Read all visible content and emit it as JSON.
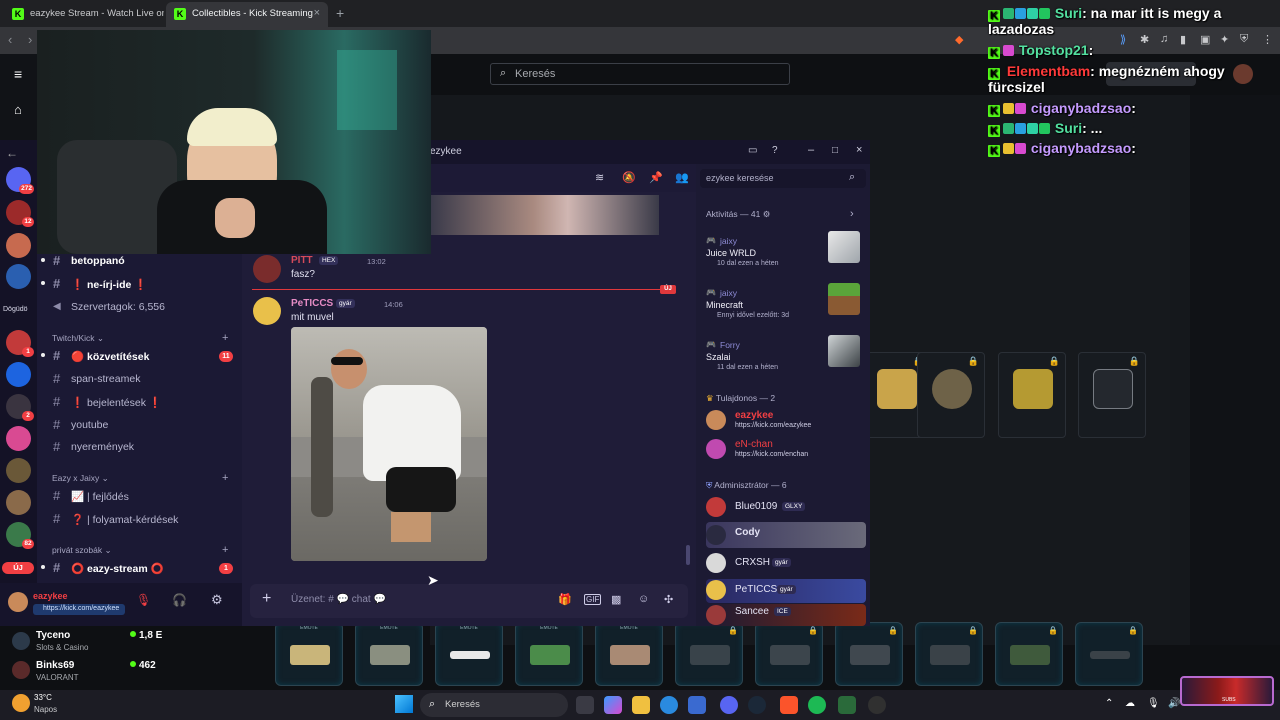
{
  "browser": {
    "tabs": [
      {
        "title": "eazykee Stream - Watch Live on Kick",
        "active": false
      },
      {
        "title": "Collectibles - Kick Streaming",
        "active": true
      }
    ],
    "new_tab": "+",
    "close": "×"
  },
  "kick": {
    "search_placeholder": "Keresés",
    "recommended": [
      {
        "name": "Tyceno",
        "category": "Slots & Casino",
        "viewers": "1,8 E"
      },
      {
        "name": "Binks69",
        "category": "VALORANT",
        "viewers": "462"
      }
    ],
    "emote_label": "EMOTE",
    "bottom_button": "SUBS"
  },
  "discord": {
    "window_title": "ezykee",
    "server_badges": [
      "272",
      "12",
      "1",
      "2",
      "82",
      "3"
    ],
    "server_labels": [
      "Dögüdö",
      "ÚJ"
    ],
    "channels": [
      {
        "name": "betoppanó",
        "bold": true
      },
      {
        "name": "❗ ne-írj-ide ❗",
        "bold": true
      },
      {
        "name": "Szervertagok: 6,556",
        "bold": false
      }
    ],
    "categories": [
      {
        "name": "Twitch/Kick",
        "channels": [
          {
            "name": "🔴 közvetítések",
            "bold": true,
            "badge": "11"
          },
          {
            "name": "span-streamek",
            "bold": false
          },
          {
            "name": "❗ bejelentések ❗",
            "bold": false
          },
          {
            "name": "youtube",
            "bold": false
          },
          {
            "name": "nyeremények",
            "bold": false
          }
        ]
      },
      {
        "name": "Eazy x Jaixy",
        "channels": [
          {
            "name": "📈 | fejlődés",
            "bold": false
          },
          {
            "name": "❓ | folyamat-kérdések",
            "bold": false
          }
        ]
      },
      {
        "name": "privát szobák",
        "channels": [
          {
            "name": "⭕ eazy-stream ⭕",
            "bold": true,
            "badge": "1"
          }
        ]
      }
    ],
    "user": {
      "name": "eazykee",
      "status": "https://kick.com/eazykee"
    },
    "messages": [
      {
        "author": "PITT",
        "tag": "HEX",
        "time": "13:02",
        "text": "fasz?"
      },
      {
        "author": "PeTICCS",
        "tag": "gyár",
        "time": "14:06",
        "text": "mit muvel"
      }
    ],
    "new_marker": "ÚJ",
    "composer_placeholder": "Üzenet: # 💬 chat 💬",
    "member_search": "ezykee keresése",
    "activity_header": "Aktivitás — 41",
    "activities": [
      {
        "user": "jaixy",
        "title": "Juice WRLD",
        "sub": "10 dal ezen a héten"
      },
      {
        "user": "jaixy",
        "title": "Minecraft",
        "sub": "Ennyi idővel ezelőtt: 3d"
      },
      {
        "user": "Forry",
        "title": "Szalai",
        "sub": "11 dal ezen a héten"
      }
    ],
    "owner_header": "Tulajdonos — 2",
    "owners": [
      {
        "name": "eazykee",
        "status": "https://kick.com/eazykee"
      },
      {
        "name": "eN-chan",
        "status": "https://kick.com/enchan"
      }
    ],
    "admin_header": "Adminisztrátor — 6",
    "admins": [
      {
        "name": "Blue0109",
        "tag": "GLXY"
      },
      {
        "name": "Cody",
        "tag": ""
      },
      {
        "name": "CRXSH",
        "tag": "gyár"
      },
      {
        "name": "PeTICCS",
        "tag": "gyár"
      },
      {
        "name": "Sancee",
        "tag": "ICE"
      }
    ]
  },
  "overlay_chat": [
    {
      "user": "Suri",
      "color": "#53e0a0",
      "text": ": na mar itt is megy a"
    },
    {
      "user": "",
      "color": "#ffffff",
      "text": "lazadozas"
    },
    {
      "user": "Topstop21",
      "color": "#53e0a0",
      "text": ":"
    },
    {
      "user": "Elementbam",
      "color": "#ff3a3a",
      "text": ": megnézném ahogy"
    },
    {
      "user": "",
      "color": "#ffffff",
      "text": "fürcsizel"
    },
    {
      "user": "ciganybadzsao",
      "color": "#c59bff",
      "text": ":"
    },
    {
      "user": "Suri",
      "color": "#53e0a0",
      "text": ": ..."
    },
    {
      "user": "ciganybadzsao",
      "color": "#c59bff",
      "text": ":"
    }
  ],
  "taskbar": {
    "weather_temp": "33°C",
    "weather_label": "Napos",
    "search": "Keresés"
  }
}
